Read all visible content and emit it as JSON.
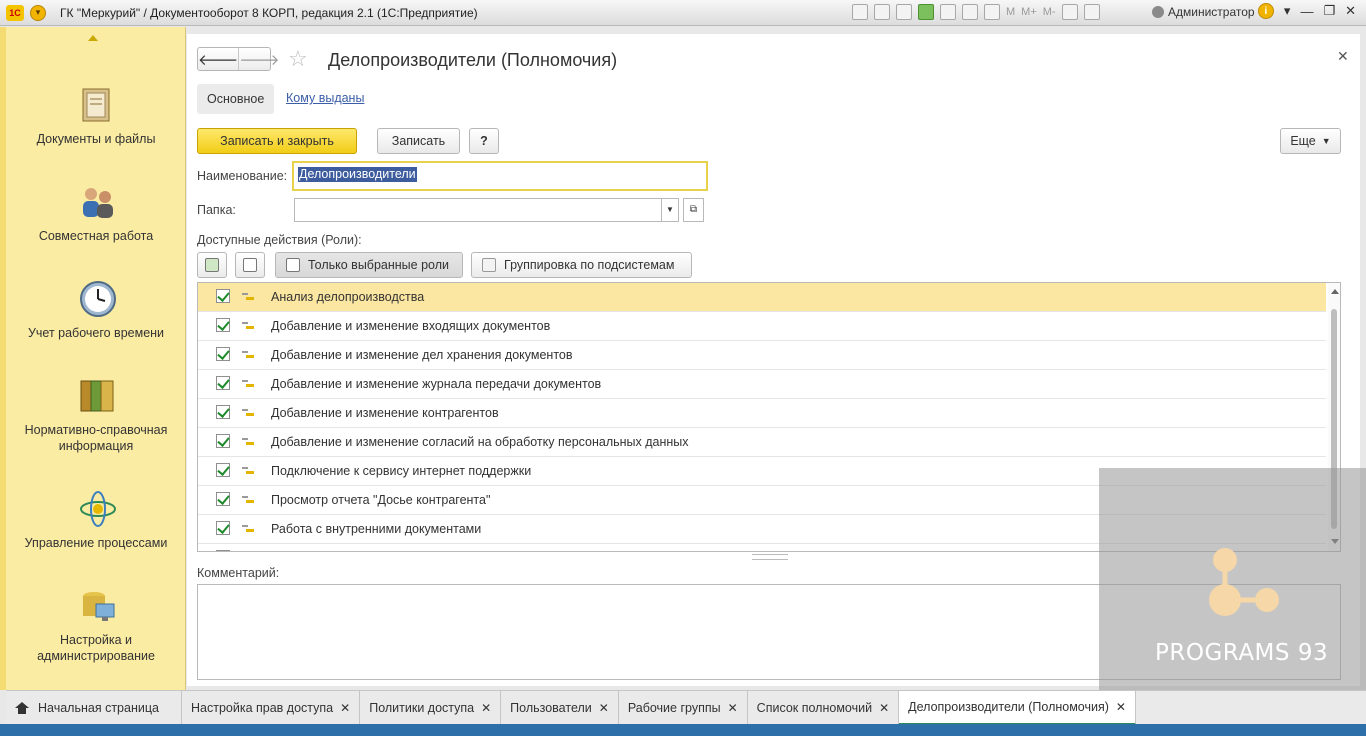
{
  "app": {
    "title": "ГК \"Меркурий\" / Документооборот 8 КОРП, редакция 2.1  (1С:Предприятие)",
    "user": "Администратор",
    "toolbar_texts": [
      "M",
      "M+",
      "M-"
    ]
  },
  "sidebar": {
    "items": [
      {
        "label": "Документы и файлы",
        "icon": "documents-icon"
      },
      {
        "label": "Совместная работа",
        "icon": "people-icon"
      },
      {
        "label": "Учет рабочего времени",
        "icon": "clock-icon"
      },
      {
        "label": "Нормативно-справочная информация",
        "icon": "folders-icon"
      },
      {
        "label": "Управление процессами",
        "icon": "process-icon"
      },
      {
        "label": "Настройка и администрирование",
        "icon": "settings-computer-icon"
      }
    ]
  },
  "form": {
    "title": "Делопроизводители (Полномочия)",
    "tabs": {
      "main": "Основное",
      "link": "Кому выданы"
    },
    "buttons": {
      "save_close": "Записать и закрыть",
      "save": "Записать",
      "help": "?",
      "more": "Еще"
    },
    "name_label": "Наименование:",
    "name_value": "Делопроизводители",
    "folder_label": "Папка:",
    "folder_value": "",
    "roles_label": "Доступные действия (Роли):",
    "role_tools": {
      "only_selected": "Только выбранные роли",
      "group_by": "Группировка по подсистемам"
    },
    "roles": [
      "Анализ делопроизводства",
      "Добавление и изменение входящих документов",
      "Добавление и изменение дел хранения документов",
      "Добавление и изменение журнала передачи документов",
      "Добавление и изменение контрагентов",
      "Добавление и изменение согласий на обработку персональных данных",
      "Подключение к сервису интернет поддержки",
      "Просмотр отчета \"Досье контрагента\"",
      "Работа с внутренними документами"
    ],
    "comment_label": "Комментарий:",
    "comment_value": ""
  },
  "watermark": {
    "text": "PROGRAMS 93"
  },
  "bottom_tabs": [
    {
      "label": "Начальная страница",
      "closable": false
    },
    {
      "label": "Настройка прав доступа",
      "closable": true
    },
    {
      "label": "Политики доступа",
      "closable": true
    },
    {
      "label": "Пользователи",
      "closable": true
    },
    {
      "label": "Рабочие группы",
      "closable": true
    },
    {
      "label": "Список полномочий",
      "closable": true
    },
    {
      "label": "Делопроизводители (Полномочия)",
      "closable": true
    }
  ],
  "colors": {
    "accent": "#f1cd16",
    "sidebar": "#fbeca3",
    "selection": "#3d5c9e",
    "row_selected": "#fbe7a1"
  }
}
